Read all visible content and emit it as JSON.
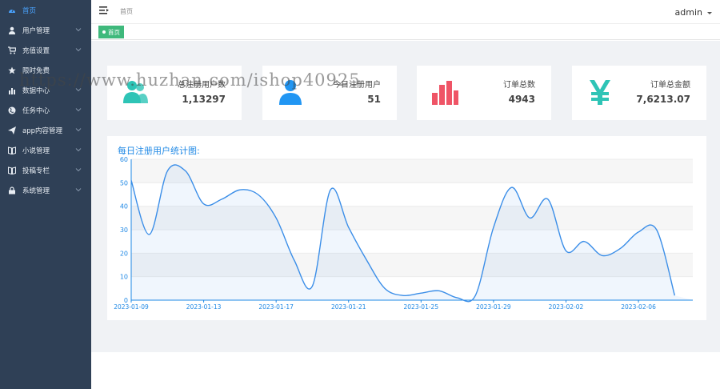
{
  "sidebar": {
    "items": [
      {
        "label": "首页",
        "icon": "dashboard-icon",
        "active": true,
        "has_children": false
      },
      {
        "label": "用户管理",
        "icon": "user-icon",
        "active": false,
        "has_children": true
      },
      {
        "label": "充值设置",
        "icon": "cart-icon",
        "active": false,
        "has_children": true
      },
      {
        "label": "限时免费",
        "icon": "star-icon",
        "active": false,
        "has_children": false
      },
      {
        "label": "数据中心",
        "icon": "bar-chart-icon",
        "active": false,
        "has_children": true
      },
      {
        "label": "任务中心",
        "icon": "globe-icon",
        "active": false,
        "has_children": true
      },
      {
        "label": "app内容管理",
        "icon": "send-icon",
        "active": false,
        "has_children": true
      },
      {
        "label": "小说管理",
        "icon": "book-icon",
        "active": false,
        "has_children": true
      },
      {
        "label": "投稿专栏",
        "icon": "book-icon",
        "active": false,
        "has_children": true
      },
      {
        "label": "系统管理",
        "icon": "lock-icon",
        "active": false,
        "has_children": true
      }
    ]
  },
  "header": {
    "breadcrumb": "首页",
    "username": "admin"
  },
  "tabs": [
    {
      "label": "首页",
      "active": true
    }
  ],
  "stats": [
    {
      "label": "总注册用户数",
      "value": "1,13297",
      "icon": "users-icon",
      "color": "#2ec4b6"
    },
    {
      "label": "今日注册用户",
      "value": "51",
      "icon": "user-icon",
      "color": "#2196f3"
    },
    {
      "label": "订单总数",
      "value": "4943",
      "icon": "bar-chart-icon",
      "color": "#ef5466"
    },
    {
      "label": "订单总金额",
      "value": "7,6213.07",
      "icon": "yen-icon",
      "color": "#2ec4b6"
    }
  ],
  "watermark": "https://www.huzhan.com/ishop40925",
  "colors": {
    "sidebar_bg": "#2f4056",
    "active_text": "#4aa3ff",
    "tab_active": "#3fb97c",
    "line": "#3b8ee8",
    "title": "#1e88e5"
  },
  "chart_data": {
    "type": "area",
    "title": "每日注册用户统计图:",
    "xlabel": "",
    "ylabel": "",
    "ylim": [
      0,
      60
    ],
    "yticks": [
      0,
      10,
      20,
      30,
      40,
      50,
      60
    ],
    "grid": true,
    "x": [
      "2023-01-09",
      "2023-01-10",
      "2023-01-11",
      "2023-01-12",
      "2023-01-13",
      "2023-01-14",
      "2023-01-15",
      "2023-01-16",
      "2023-01-17",
      "2023-01-18",
      "2023-01-19",
      "2023-01-20",
      "2023-01-21",
      "2023-01-22",
      "2023-01-23",
      "2023-01-24",
      "2023-01-25",
      "2023-01-26",
      "2023-01-27",
      "2023-01-28",
      "2023-01-29",
      "2023-01-30",
      "2023-01-31",
      "2023-02-01",
      "2023-02-02",
      "2023-02-03",
      "2023-02-04",
      "2023-02-05",
      "2023-02-06",
      "2023-02-07",
      "2023-02-08",
      "2023-02-09"
    ],
    "xtick_labels": [
      "2023-01-09",
      "2023-01-13",
      "2023-01-17",
      "2023-01-21",
      "2023-01-25",
      "2023-01-29",
      "2023-02-02",
      "2023-02-06"
    ],
    "series": [
      {
        "values": [
          51,
          28,
          55,
          55,
          41,
          43,
          47,
          45,
          35,
          17,
          6,
          47,
          31,
          17,
          5,
          2,
          3,
          4,
          1,
          2,
          31,
          48,
          35,
          43,
          21,
          25,
          19,
          22,
          29,
          30,
          2
        ]
      }
    ]
  }
}
